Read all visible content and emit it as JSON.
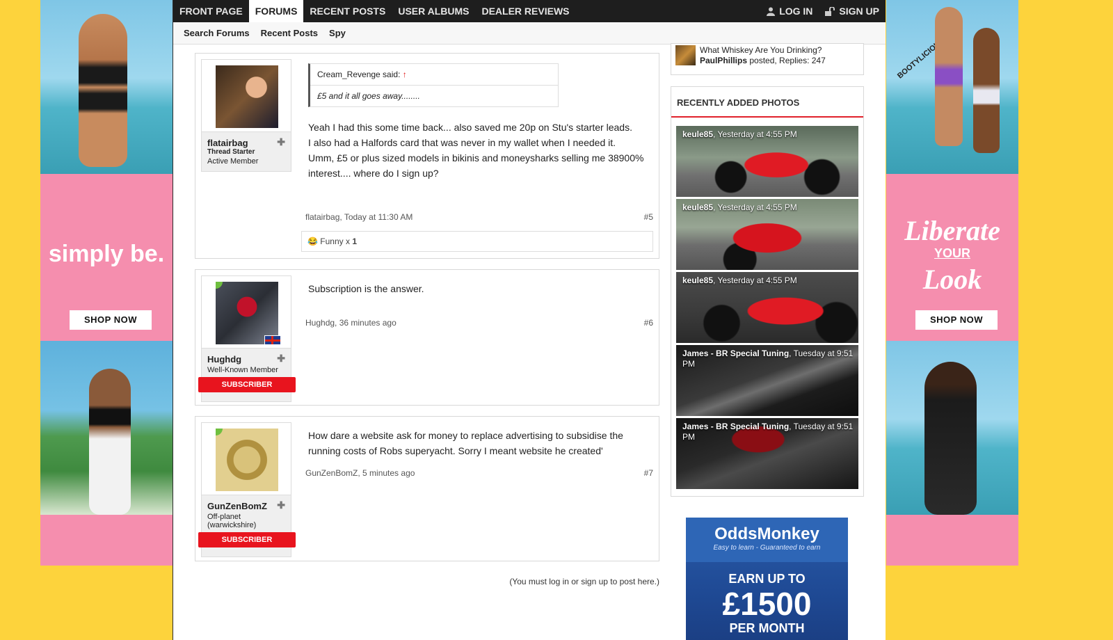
{
  "nav": {
    "tabs": [
      "FRONT PAGE",
      "FORUMS",
      "RECENT POSTS",
      "USER ALBUMS",
      "DEALER REVIEWS"
    ],
    "active_tab": "FORUMS",
    "login_label": "LOG IN",
    "signup_label": "SIGN UP"
  },
  "subnav": [
    "Search Forums",
    "Recent Posts",
    "Spy"
  ],
  "posts": [
    {
      "username": "flatairbag",
      "starter_label": "Thread Starter",
      "title": "Active Member",
      "quote_author": "Cream_Revenge said:",
      "quote_text": "£5 and it all goes away........",
      "body": [
        "Yeah I had this some time back... also saved me 20p on Stu's starter leads.",
        "I also had a Halfords card that was never in my wallet when I needed it.",
        "Umm, £5 or plus sized models in bikinis and moneysharks selling me 38900% interest.... where do I sign up?"
      ],
      "meta": "flatairbag, Today at 11:30 AM",
      "number": "#5",
      "reaction_label": "Funny x",
      "reaction_count": "1"
    },
    {
      "username": "Hughdg",
      "title": "Well-Known Member",
      "badge": "SUBSCRIBER",
      "body": [
        "Subscription is the answer."
      ],
      "meta": "Hughdg, 36 minutes ago",
      "number": "#6"
    },
    {
      "username": "GunZenBomZ",
      "title": "Off-planet (warwickshire)",
      "badge": "SUBSCRIBER",
      "body": [
        "How dare a website ask for money to replace advertising to subsidise the running costs of Robs superyacht. Sorry I meant website he created'"
      ],
      "meta": "GunZenBomZ, 5 minutes ago",
      "number": "#7"
    }
  ],
  "login_note": "(You must log in or sign up to post here.)",
  "sidebar": {
    "thread_title": "What Whiskey Are You Drinking?",
    "thread_user": "PaulPhillips",
    "thread_meta": "posted, Replies: 247",
    "photos_heading": "RECENTLY ADDED PHOTOS",
    "photos": [
      {
        "user": "keule85",
        "when": ", Yesterday at 4:55 PM"
      },
      {
        "user": "keule85",
        "when": ", Yesterday at 4:55 PM"
      },
      {
        "user": "keule85",
        "when": ", Yesterday at 4:55 PM"
      },
      {
        "user": "James - BR Special Tuning",
        "when": ", Tuesday at 9:51 PM"
      },
      {
        "user": "James - BR Special Tuning",
        "when": ", Tuesday at 9:51 PM"
      }
    ]
  },
  "ads": {
    "left_brand": "simply be.",
    "left_button": "SHOP NOW",
    "right_tag": "BOOTYLICIOUS",
    "right_line1": "Liberate",
    "right_line2": "YOUR",
    "right_line3": "Look",
    "right_button": "SHOP NOW",
    "odds_logo": "OddsMonkey",
    "odds_tagline": "Easy to learn - Guaranteed to earn",
    "odds_earn": "EARN UP TO",
    "odds_amount": "£1500",
    "odds_per": "PER MONTH"
  },
  "colors": {
    "background": "#fdd33c",
    "nav_dark": "#1e1e1e",
    "subscriber_red": "#e8141e",
    "ad_pink": "#f58eae",
    "odds_blue": "#1f4a95"
  }
}
